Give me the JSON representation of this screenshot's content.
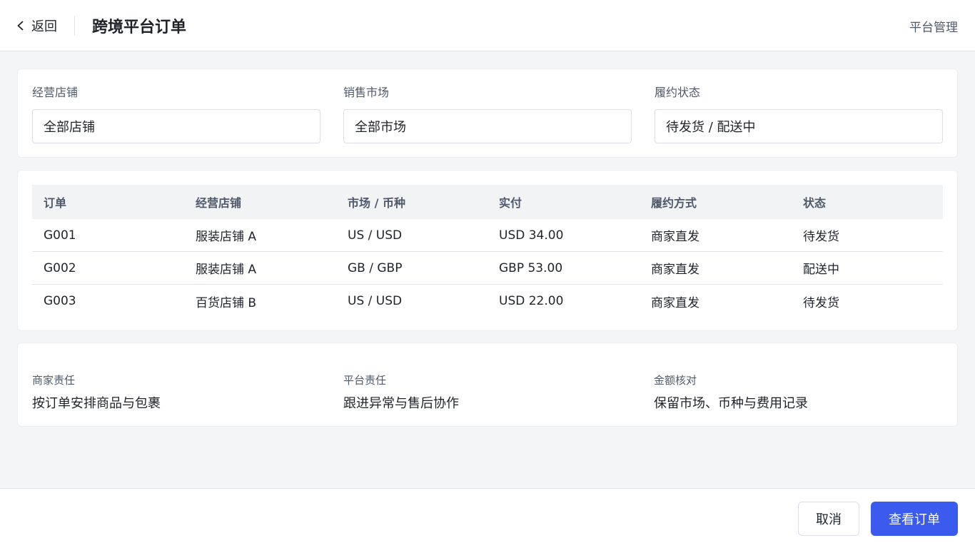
{
  "header": {
    "back_label": "返回",
    "title": "跨境平台订单",
    "platform_link": "平台管理"
  },
  "filters": [
    {
      "label": "经营店铺",
      "value": "全部店铺"
    },
    {
      "label": "销售市场",
      "value": "全部市场"
    },
    {
      "label": "履约状态",
      "value": "待发货 / 配送中"
    }
  ],
  "table": {
    "columns": [
      "订单",
      "经营店铺",
      "市场 / 币种",
      "实付",
      "履约方式",
      "状态"
    ],
    "rows": [
      [
        "G001",
        "服装店铺 A",
        "US / USD",
        "USD 34.00",
        "商家直发",
        "待发货"
      ],
      [
        "G002",
        "服装店铺 A",
        "GB / GBP",
        "GBP 53.00",
        "商家直发",
        "配送中"
      ],
      [
        "G003",
        "百货店铺 B",
        "US / USD",
        "USD 22.00",
        "商家直发",
        "待发货"
      ]
    ]
  },
  "info": [
    {
      "label": "商家责任",
      "value": "按订单安排商品与包裹"
    },
    {
      "label": "平台责任",
      "value": "跟进异常与售后协作"
    },
    {
      "label": "金额核对",
      "value": "保留市场、币种与费用记录"
    }
  ],
  "footer": {
    "cancel_label": "取消",
    "primary_label": "查看订单"
  },
  "colors": {
    "primary": "#3b5bee",
    "background": "#f4f5f7"
  }
}
